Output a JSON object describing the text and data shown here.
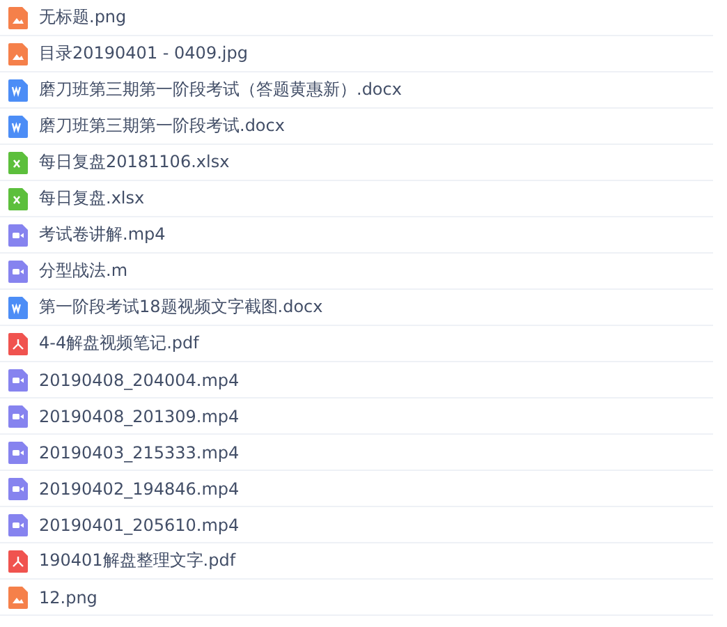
{
  "files": [
    {
      "kind": "image",
      "name": "无标题.png"
    },
    {
      "kind": "image",
      "name": "目录20190401 - 0409.jpg"
    },
    {
      "kind": "word",
      "name": "磨刀班第三期第一阶段考试（答题黄惠新）.docx"
    },
    {
      "kind": "word",
      "name": "磨刀班第三期第一阶段考试.docx"
    },
    {
      "kind": "excel",
      "name": "每日复盘20181106.xlsx"
    },
    {
      "kind": "excel",
      "name": "每日复盘.xlsx"
    },
    {
      "kind": "video",
      "name": "考试卷讲解.mp4"
    },
    {
      "kind": "video",
      "name": "分型战法.m"
    },
    {
      "kind": "word",
      "name": "第一阶段考试18题视频文字截图.docx"
    },
    {
      "kind": "pdf",
      "name": "4-4解盘视频笔记.pdf"
    },
    {
      "kind": "video",
      "name": "20190408_204004.mp4"
    },
    {
      "kind": "video",
      "name": "20190408_201309.mp4"
    },
    {
      "kind": "video",
      "name": "20190403_215333.mp4"
    },
    {
      "kind": "video",
      "name": "20190402_194846.mp4"
    },
    {
      "kind": "video",
      "name": "20190401_205610.mp4"
    },
    {
      "kind": "pdf",
      "name": "190401解盘整理文字.pdf"
    },
    {
      "kind": "image",
      "name": "12.png"
    }
  ]
}
